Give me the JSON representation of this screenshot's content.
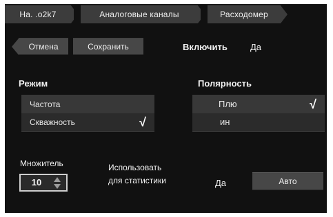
{
  "breadcrumb": {
    "items": [
      {
        "label": "Ha. .o2k7"
      },
      {
        "label": "Аналоговые каналы"
      },
      {
        "label": "Расходомер"
      }
    ]
  },
  "toolbar": {
    "cancel_label": "Отмена",
    "save_label": "Сохранить",
    "enable_label": "Включить",
    "enable_value": "Да"
  },
  "mode": {
    "title": "Режим",
    "options": [
      {
        "label": "Частота",
        "selected": false
      },
      {
        "label": "Скважность",
        "selected": true
      }
    ],
    "check_glyph": "√"
  },
  "polarity": {
    "title": "Полярность",
    "options": [
      {
        "label": "Плю",
        "selected": true
      },
      {
        "label": "ин",
        "selected": false
      }
    ],
    "check_glyph": "√"
  },
  "multiplier": {
    "label": "Множитель",
    "value": "10"
  },
  "statistics": {
    "label_line1": "Использовать",
    "label_line2": "для статистики",
    "value": "Да"
  },
  "auto_button": {
    "label": "Авто"
  }
}
